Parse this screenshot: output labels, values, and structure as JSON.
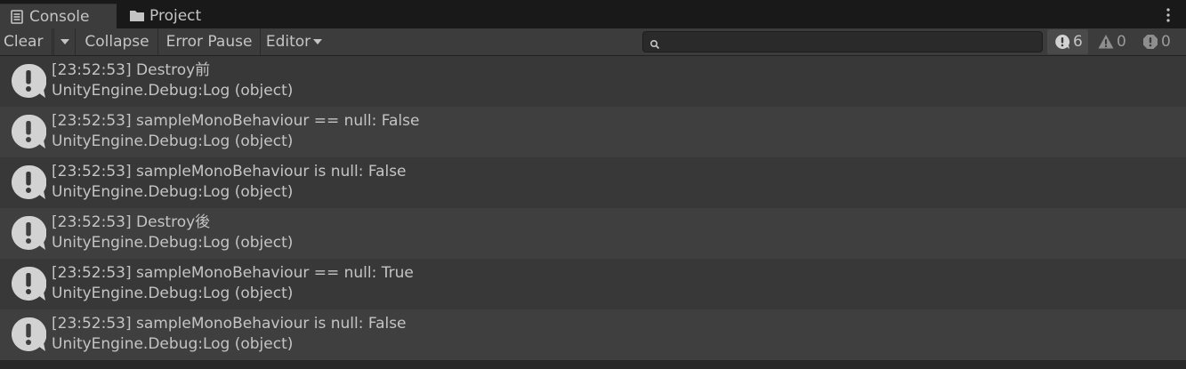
{
  "tabs": [
    {
      "label": "Console",
      "icon": "console-icon",
      "active": true
    },
    {
      "label": "Project",
      "icon": "folder-icon",
      "active": false
    }
  ],
  "toolbar": {
    "clear_label": "Clear",
    "collapse_label": "Collapse",
    "error_pause_label": "Error Pause",
    "editor_label": "Editor",
    "search": {
      "value": "",
      "placeholder": ""
    }
  },
  "counters": {
    "info": "6",
    "warning": "0",
    "error": "0"
  },
  "logs": [
    {
      "message": "[23:52:53] Destroy前",
      "stack": "UnityEngine.Debug:Log (object)"
    },
    {
      "message": "[23:52:53] sampleMonoBehaviour == null: False",
      "stack": "UnityEngine.Debug:Log (object)"
    },
    {
      "message": "[23:52:53] sampleMonoBehaviour is null: False",
      "stack": "UnityEngine.Debug:Log (object)"
    },
    {
      "message": "[23:52:53] Destroy後",
      "stack": "UnityEngine.Debug:Log (object)"
    },
    {
      "message": "[23:52:53] sampleMonoBehaviour == null: True",
      "stack": "UnityEngine.Debug:Log (object)"
    },
    {
      "message": "[23:52:53] sampleMonoBehaviour is null: False",
      "stack": "UnityEngine.Debug:Log (object)"
    }
  ],
  "colors": {
    "background": "#282828",
    "toolbar": "#3c3c3c",
    "row_even": "#383838",
    "row_odd": "#3f3f3f",
    "text": "#c4c4c4",
    "info_icon": "#d2d2d2"
  }
}
